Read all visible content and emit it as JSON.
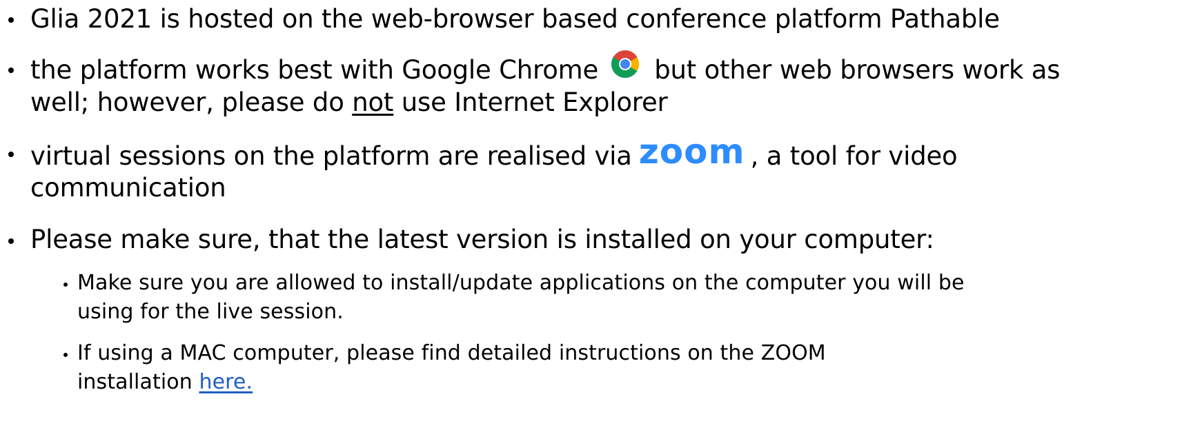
{
  "bullets": {
    "b1": "Glia 2021 is hosted on the web-browser based conference platform Pathable",
    "b2_part1": "the platform works best with Google Chrome",
    "b2_part2": "but other web browsers work as",
    "b2_line2_a": "well; however, please do ",
    "b2_line2_not": "not",
    "b2_line2_b": " use Internet Explorer",
    "b3_part1": "virtual sessions on the platform are realised via",
    "b3_logo": "zoom",
    "b3_part2": ", a tool for video",
    "b3_line2": "communication",
    "b4": "Please make sure, that the latest version is installed on your computer:"
  },
  "sub_bullets": {
    "s1_line1": "Make sure you are allowed to install/update applications on the computer you will be",
    "s1_line2": "using for the live session.",
    "s2_line1": "If using a MAC computer, please find detailed instructions on the ZOOM",
    "s2_line2_a": "installation ",
    "s2_link": "here."
  },
  "icons": {
    "chrome": "google-chrome-logo",
    "zoom": "zoom-logo"
  },
  "colors": {
    "text": "#000000",
    "link": "#1f5fbf",
    "zoom_blue": "#2d8cff"
  }
}
